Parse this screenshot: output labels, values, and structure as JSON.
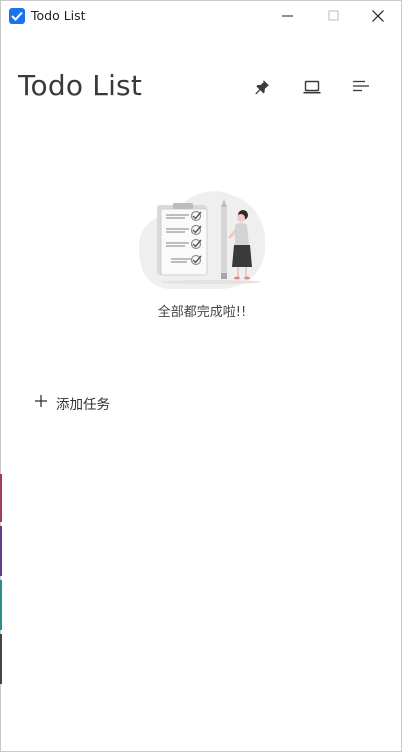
{
  "window": {
    "title": "Todo List"
  },
  "header": {
    "title": "Todo List"
  },
  "toolbar": {
    "pin_icon": "pin-icon",
    "monitor_icon": "monitor-icon",
    "menu_icon": "menu-icon"
  },
  "empty_state": {
    "message": "全部都完成啦!!"
  },
  "add_task": {
    "label": "添加任务"
  },
  "colors": {
    "accent": "#1a73e8",
    "text_dark": "#3a3a3a",
    "illustration_bg": "#f0f0f0"
  }
}
